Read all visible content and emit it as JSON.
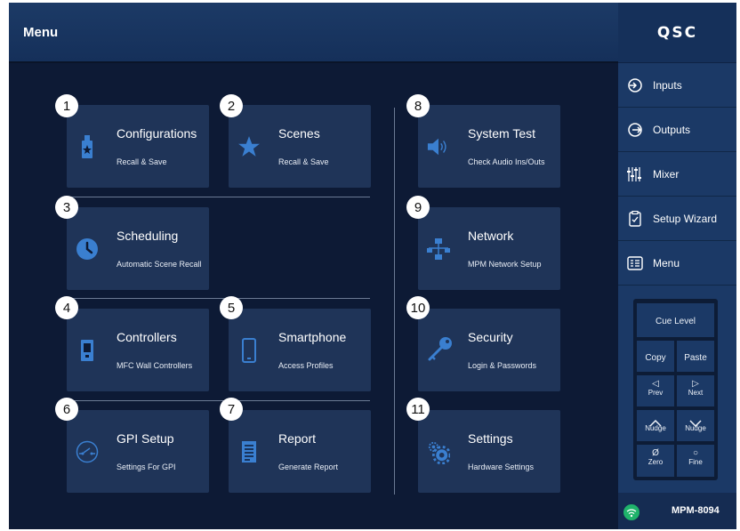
{
  "header": {
    "title": "Menu"
  },
  "brand": {
    "logo": "QSC"
  },
  "tiles": [
    {
      "num": "1",
      "title": "Configurations",
      "subtitle": "Recall & Save",
      "icon": "usb-drive-icon"
    },
    {
      "num": "2",
      "title": "Scenes",
      "subtitle": "Recall & Save",
      "icon": "star-icon"
    },
    {
      "num": "3",
      "title": "Scheduling",
      "subtitle": "Automatic Scene Recall",
      "icon": "clock-icon"
    },
    {
      "num": "4",
      "title": "Controllers",
      "subtitle": "MFC Wall Controllers",
      "icon": "wall-controller-icon"
    },
    {
      "num": "5",
      "title": "Smartphone",
      "subtitle": "Access Profiles",
      "icon": "smartphone-icon"
    },
    {
      "num": "6",
      "title": "GPI Setup",
      "subtitle": "Settings For GPI",
      "icon": "gpi-switch-icon"
    },
    {
      "num": "7",
      "title": "Report",
      "subtitle": "Generate Report",
      "icon": "document-icon"
    },
    {
      "num": "8",
      "title": "System Test",
      "subtitle": "Check Audio Ins/Outs",
      "icon": "speaker-icon"
    },
    {
      "num": "9",
      "title": "Network",
      "subtitle": "MPM Network Setup",
      "icon": "network-icon"
    },
    {
      "num": "10",
      "title": "Security",
      "subtitle": "Login & Passwords",
      "icon": "key-icon"
    },
    {
      "num": "11",
      "title": "Settings",
      "subtitle": "Hardware Settings",
      "icon": "gears-icon"
    }
  ],
  "nav": [
    {
      "label": "Inputs",
      "icon": "input-arrow-icon"
    },
    {
      "label": "Outputs",
      "icon": "output-arrow-icon"
    },
    {
      "label": "Mixer",
      "icon": "mixer-faders-icon"
    },
    {
      "label": "Setup Wizard",
      "icon": "wizard-clipboard-icon"
    },
    {
      "label": "Menu",
      "icon": "menu-list-icon"
    }
  ],
  "cue": {
    "cue_level": "Cue Level",
    "copy": "Copy",
    "paste": "Paste",
    "prev": "Prev",
    "next": "Next",
    "nudge_up": "Nudge",
    "nudge_down": "Nudge",
    "zero": "Zero",
    "fine": "Fine",
    "prev_glyph": "◁",
    "next_glyph": "▷",
    "zero_glyph": "Ø",
    "fine_glyph": "○"
  },
  "status": {
    "model": "MPM-8094",
    "wifi_color": "#1fb36b"
  },
  "colors": {
    "background": "#0d1a35",
    "tile": "#1f3458",
    "accent_icon": "#3a7fd0",
    "panel": "#1b3966"
  }
}
